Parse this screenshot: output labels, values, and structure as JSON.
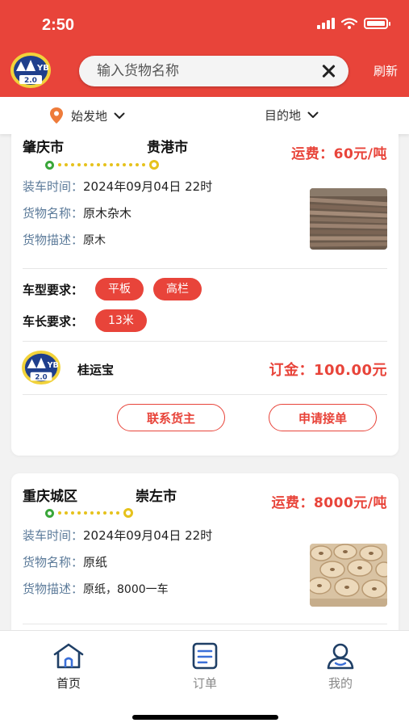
{
  "status_bar": {
    "time": "2:50"
  },
  "header": {
    "search_placeholder": "输入货物名称",
    "refresh_label": "刷新",
    "logo_text": "YB 2.0"
  },
  "filters": {
    "origin_label": "始发地",
    "destination_label": "目的地"
  },
  "orders": [
    {
      "from": "肇庆市",
      "to": "贵港市",
      "freight": "运费：60元/吨",
      "load_time_label": "装车时间：",
      "load_time": "2024年09月04日 22时",
      "goods_name_label": "货物名称：",
      "goods_name": "原木杂木",
      "goods_desc_label": "货物描述：",
      "goods_desc": "原木",
      "vehicle_type_label": "车型要求：",
      "vehicle_types": [
        "平板",
        "高栏"
      ],
      "vehicle_length_label": "车长要求：",
      "vehicle_lengths": [
        "13米"
      ],
      "shipper": "桂运宝",
      "deposit": "订金：100.00元",
      "contact_button": "联系货主",
      "accept_button": "申请接单"
    },
    {
      "from": "重庆城区",
      "to": "崇左市",
      "freight": "运费：8000元/吨",
      "load_time_label": "装车时间：",
      "load_time": "2024年09月04日 22时",
      "goods_name_label": "货物名称：",
      "goods_name": "原纸",
      "goods_desc_label": "货物描述：",
      "goods_desc": "原纸，8000一车"
    }
  ],
  "tabbar": {
    "items": [
      {
        "label": "首页",
        "icon": "home-icon",
        "active": true
      },
      {
        "label": "订单",
        "icon": "order-icon",
        "active": false
      },
      {
        "label": "我的",
        "icon": "profile-icon",
        "active": false
      }
    ]
  },
  "colors": {
    "brand": "#e8443a",
    "label": "#5b7a99",
    "route_start": "#3aa63a",
    "route_dot": "#e6c21c"
  }
}
